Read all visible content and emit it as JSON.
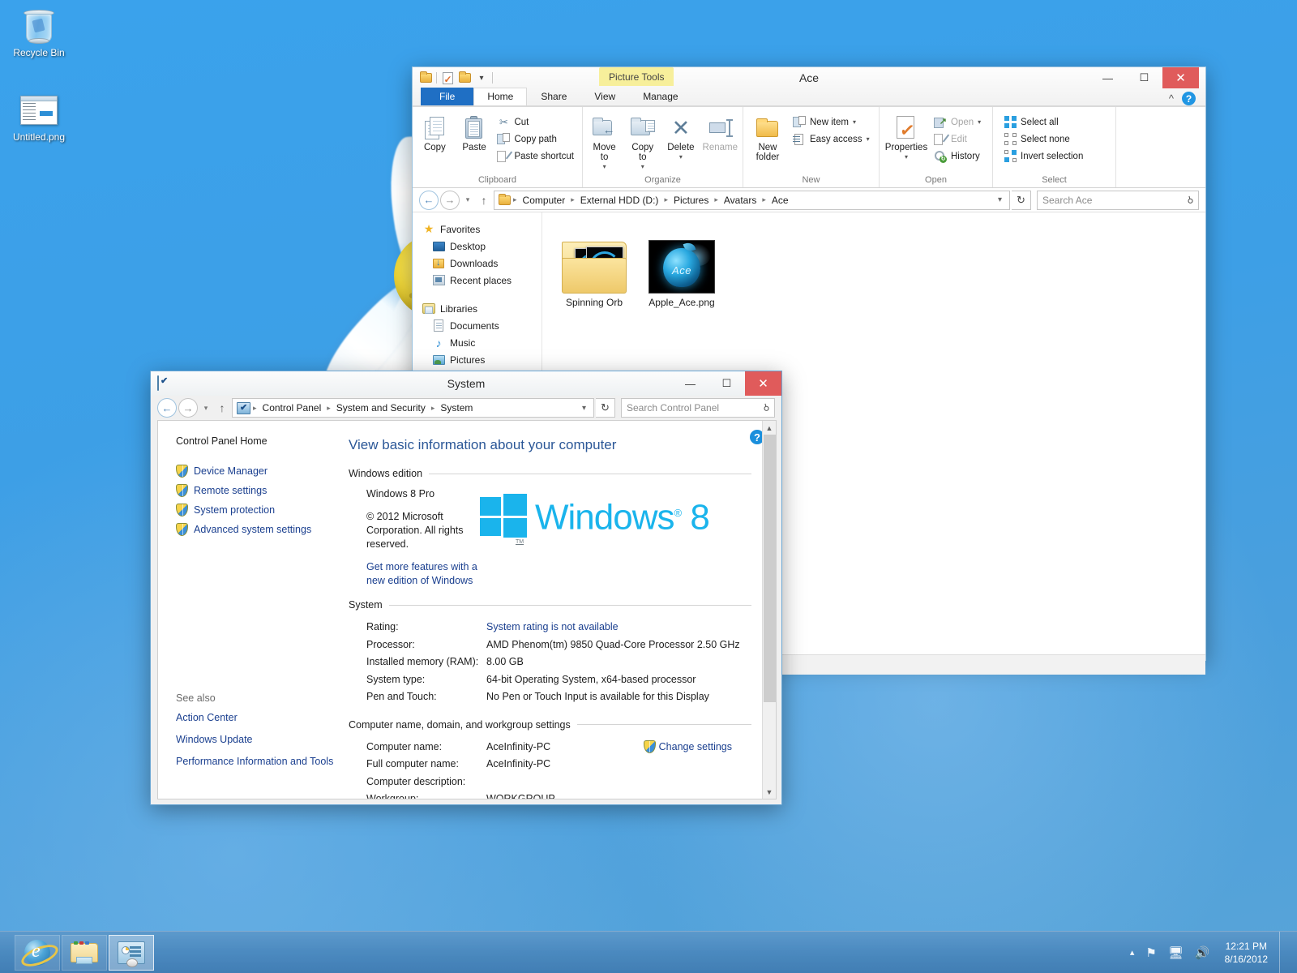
{
  "desktop": {
    "icons": [
      {
        "label": "Recycle Bin",
        "icon": "recycle-bin-icon"
      },
      {
        "label": "Untitled.png",
        "icon": "png-file-icon"
      }
    ]
  },
  "explorer": {
    "title": "Ace",
    "quick_access": [
      "folder-icon",
      "properties-icon",
      "new-folder-icon",
      "customize-caret-icon"
    ],
    "contextual_tab_group": "Picture Tools",
    "tabs": [
      {
        "label": "File",
        "type": "file"
      },
      {
        "label": "Home",
        "type": "active"
      },
      {
        "label": "Share",
        "type": "normal"
      },
      {
        "label": "View",
        "type": "normal"
      },
      {
        "label": "Manage",
        "type": "normal"
      }
    ],
    "ribbon": {
      "groups": [
        {
          "name": "Clipboard",
          "big": [
            {
              "label": "Copy",
              "icon": "copy-icon"
            },
            {
              "label": "Paste",
              "icon": "paste-icon"
            }
          ],
          "small": [
            {
              "label": "Cut",
              "icon": "scissors-icon",
              "disabled": false
            },
            {
              "label": "Copy path",
              "icon": "copy-path-icon",
              "disabled": false
            },
            {
              "label": "Paste shortcut",
              "icon": "paste-shortcut-icon",
              "disabled": false
            }
          ]
        },
        {
          "name": "Organize",
          "big": [
            {
              "label": "Move\nto",
              "icon": "move-to-icon",
              "caret": true
            },
            {
              "label": "Copy\nto",
              "icon": "copy-to-icon",
              "caret": true
            },
            {
              "label": "Delete",
              "icon": "delete-icon",
              "caret": true
            },
            {
              "label": "Rename",
              "icon": "rename-icon",
              "disabled": true
            }
          ]
        },
        {
          "name": "New",
          "big": [
            {
              "label": "New\nfolder",
              "icon": "new-folder-icon"
            }
          ],
          "small": [
            {
              "label": "New item",
              "icon": "new-item-icon",
              "caret": true
            },
            {
              "label": "Easy access",
              "icon": "easy-access-icon",
              "caret": true
            }
          ]
        },
        {
          "name": "Open",
          "big": [
            {
              "label": "Properties",
              "icon": "properties-icon",
              "caret": true
            }
          ],
          "small": [
            {
              "label": "Open",
              "icon": "open-icon",
              "caret": true,
              "disabled": true
            },
            {
              "label": "Edit",
              "icon": "edit-icon",
              "disabled": true
            },
            {
              "label": "History",
              "icon": "history-icon",
              "disabled": false
            }
          ]
        },
        {
          "name": "Select",
          "small": [
            {
              "label": "Select all",
              "icon": "select-all-icon"
            },
            {
              "label": "Select none",
              "icon": "select-none-icon"
            },
            {
              "label": "Invert selection",
              "icon": "invert-selection-icon"
            }
          ]
        }
      ]
    },
    "address": {
      "crumbs": [
        "Computer",
        "External HDD (D:)",
        "Pictures",
        "Avatars",
        "Ace"
      ],
      "search_placeholder": "Search Ace"
    },
    "nav_pane": [
      {
        "label": "Favorites",
        "icon": "star-icon",
        "level": 0
      },
      {
        "label": "Desktop",
        "icon": "desktop-icon",
        "level": 1
      },
      {
        "label": "Downloads",
        "icon": "downloads-icon",
        "level": 1
      },
      {
        "label": "Recent places",
        "icon": "recent-places-icon",
        "level": 1
      },
      {
        "label": "Libraries",
        "icon": "libraries-icon",
        "level": 0
      },
      {
        "label": "Documents",
        "icon": "documents-icon",
        "level": 1
      },
      {
        "label": "Music",
        "icon": "music-icon",
        "level": 1
      },
      {
        "label": "Pictures",
        "icon": "pictures-icon",
        "level": 1
      }
    ],
    "files": [
      {
        "name": "Spinning Orb",
        "type": "folder"
      },
      {
        "name": "Apple_Ace.png",
        "type": "image",
        "thumb_text": "Ace"
      }
    ],
    "window_buttons": {
      "minimize": "—",
      "maximize": "☐",
      "close": "✕"
    }
  },
  "system_window": {
    "title": "System",
    "address": {
      "crumbs": [
        "Control Panel",
        "System and Security",
        "System"
      ],
      "search_placeholder": "Search Control Panel"
    },
    "left_nav": {
      "home": "Control Panel Home",
      "links": [
        "Device Manager",
        "Remote settings",
        "System protection",
        "Advanced system settings"
      ],
      "see_also_heading": "See also",
      "see_also": [
        "Action Center",
        "Windows Update",
        "Performance Information and Tools"
      ]
    },
    "heading": "View basic information about your computer",
    "sections": {
      "edition": {
        "title": "Windows edition",
        "product": "Windows 8 Pro",
        "copyright": "© 2012 Microsoft Corporation. All rights reserved.",
        "upgrade_link": "Get more features with a new edition of Windows",
        "logo_text": "Windows",
        "logo_version": "8",
        "logo_registered": "®",
        "logo_tm": "TM"
      },
      "system": {
        "title": "System",
        "rows": [
          {
            "key": "Rating:",
            "value": "System rating is not available",
            "link": true
          },
          {
            "key": "Processor:",
            "value": "AMD Phenom(tm) 9850 Quad-Core Processor   2.50 GHz",
            "link": false
          },
          {
            "key": "Installed memory (RAM):",
            "value": "8.00 GB",
            "link": false
          },
          {
            "key": "System type:",
            "value": "64-bit Operating System, x64-based processor",
            "link": false
          },
          {
            "key": "Pen and Touch:",
            "value": "No Pen or Touch Input is available for this Display",
            "link": false
          }
        ]
      },
      "computer_name": {
        "title": "Computer name, domain, and workgroup settings",
        "rows": [
          {
            "key": "Computer name:",
            "value": "AceInfinity-PC"
          },
          {
            "key": "Full computer name:",
            "value": "AceInfinity-PC"
          },
          {
            "key": "Computer description:",
            "value": ""
          },
          {
            "key": "Workgroup:",
            "value": "WORKGROUP"
          }
        ],
        "change_settings": "Change settings"
      }
    },
    "window_buttons": {
      "minimize": "—",
      "maximize": "☐",
      "close": "✕"
    }
  },
  "taskbar": {
    "buttons": [
      {
        "name": "internet-explorer",
        "active": false
      },
      {
        "name": "file-explorer",
        "active": false
      },
      {
        "name": "control-panel-system",
        "active": true
      }
    ],
    "tray": {
      "show_hidden": "▴",
      "icons": [
        "action-center-flag-icon",
        "network-icon",
        "volume-icon"
      ],
      "time": "12:21 PM",
      "date": "8/16/2012"
    }
  },
  "colors": {
    "accent": "#1f6fc4",
    "windows_blue": "#1ab4ec",
    "close_red": "#e05b5b",
    "contextual_tab": "#f7ef9b",
    "link": "#1a3f8f"
  }
}
